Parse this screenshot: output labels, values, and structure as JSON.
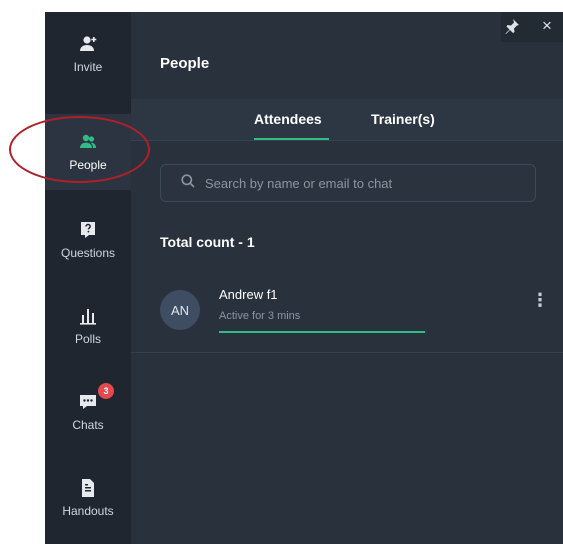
{
  "sidebar": {
    "items": [
      {
        "label": "Invite",
        "icon": "invite-icon"
      },
      {
        "label": "People",
        "icon": "people-icon",
        "active": true
      },
      {
        "label": "Questions",
        "icon": "question-icon"
      },
      {
        "label": "Polls",
        "icon": "poll-chart-icon"
      },
      {
        "label": "Chats",
        "icon": "chat-icon",
        "badge": "3"
      },
      {
        "label": "Handouts",
        "icon": "document-icon"
      }
    ]
  },
  "panel": {
    "title": "People",
    "tabs": [
      {
        "label": "Attendees",
        "active": true
      },
      {
        "label": "Trainer(s)",
        "active": false
      }
    ],
    "search": {
      "placeholder": "Search by name or email to chat",
      "value": ""
    },
    "total_count": "Total count - 1",
    "attendees": [
      {
        "initials": "AN",
        "name": "Andrew f1",
        "status": "Active for 3 mins"
      }
    ],
    "controls": {
      "pin": "pin-icon",
      "close": "×"
    }
  },
  "colors": {
    "rail_bg": "#1f2630",
    "panel_bg": "#28313c",
    "accent": "#2ebd85",
    "badge": "#e5484d",
    "annotation": "#b0202a"
  }
}
